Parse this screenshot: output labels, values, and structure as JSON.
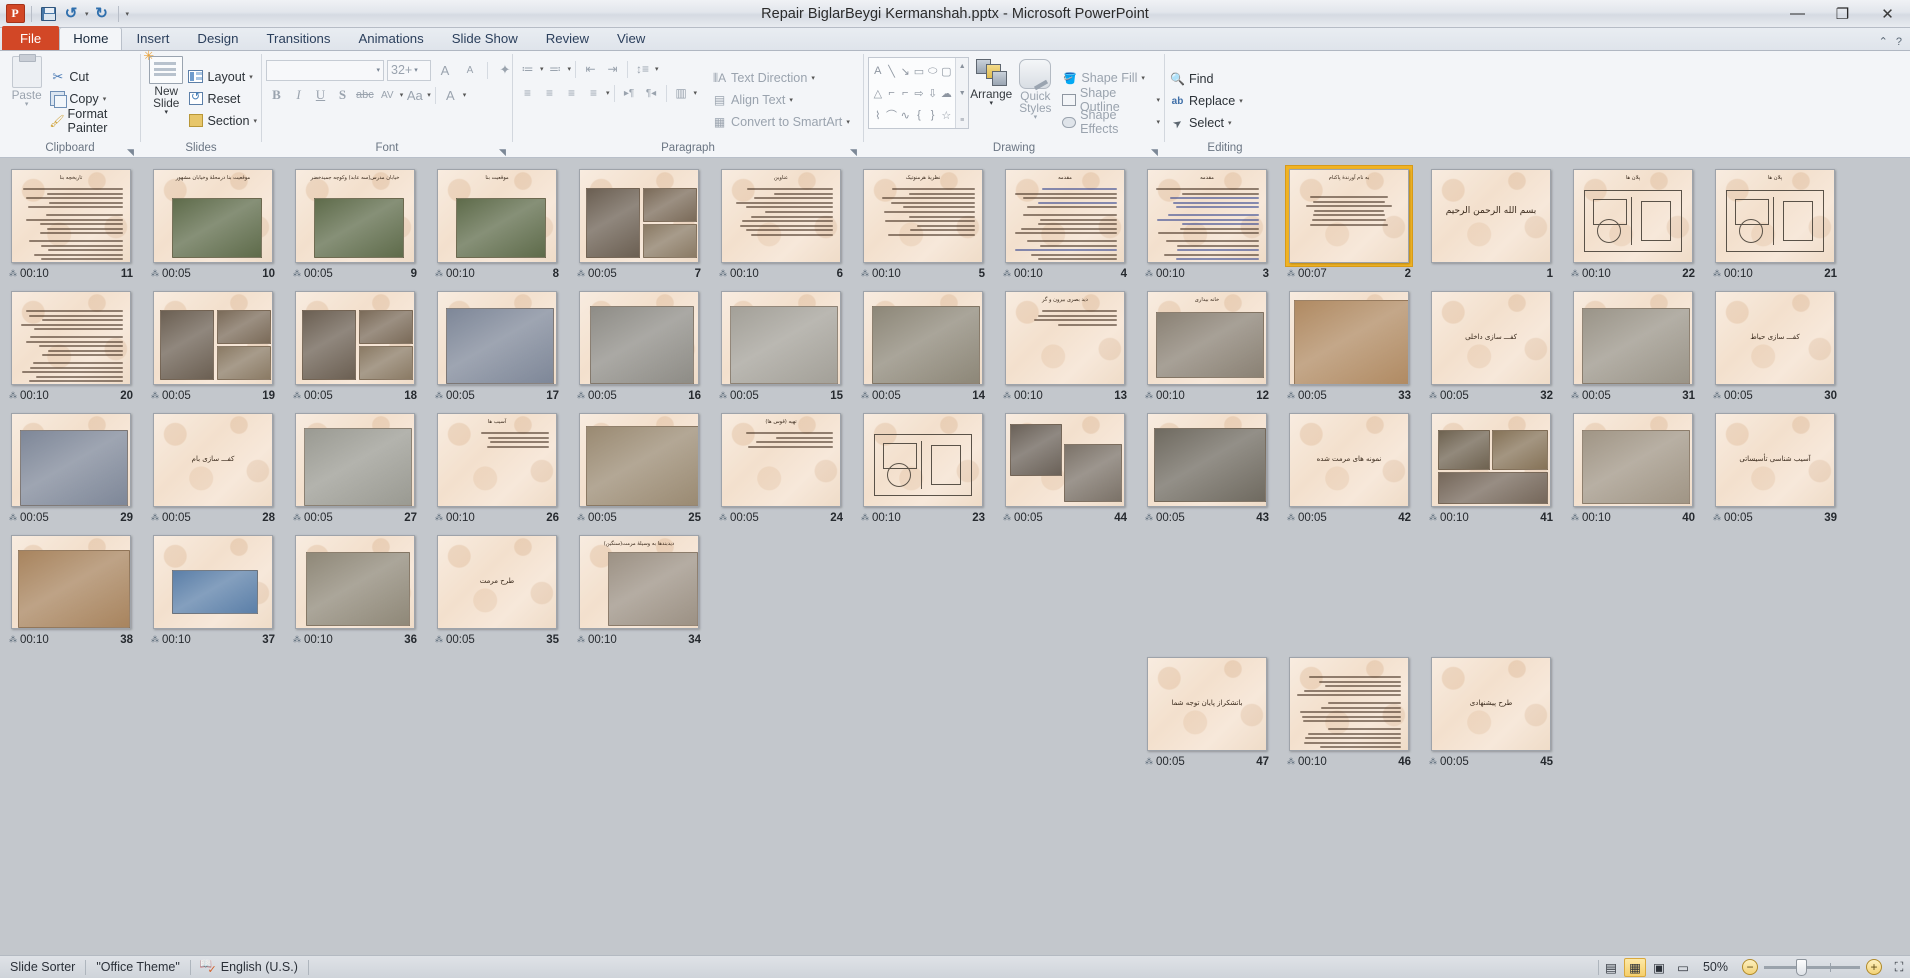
{
  "window": {
    "title": "Repair BiglarBeygi Kermanshah.pptx  -  Microsoft PowerPoint",
    "minimize": "—",
    "restore": "❐",
    "close": "✕"
  },
  "quick_access": {
    "app_logo": "P",
    "save": "save-icon",
    "undo": "↺",
    "undo_caret": "▾",
    "redo": "↻",
    "customize": "▾"
  },
  "tabs": [
    {
      "label": "File",
      "active": false,
      "file": true
    },
    {
      "label": "Home",
      "active": true,
      "file": false
    },
    {
      "label": "Insert",
      "active": false,
      "file": false
    },
    {
      "label": "Design",
      "active": false,
      "file": false
    },
    {
      "label": "Transitions",
      "active": false,
      "file": false
    },
    {
      "label": "Animations",
      "active": false,
      "file": false
    },
    {
      "label": "Slide Show",
      "active": false,
      "file": false
    },
    {
      "label": "Review",
      "active": false,
      "file": false
    },
    {
      "label": "View",
      "active": false,
      "file": false
    }
  ],
  "tabstrip_right": {
    "minimize_ribbon": "⌃",
    "help": "?"
  },
  "ribbon": {
    "clipboard": {
      "label": "Clipboard",
      "paste": "Paste",
      "paste_caret": "▾",
      "cut": "Cut",
      "copy": "Copy",
      "copy_caret": "▾",
      "format_painter": "Format Painter",
      "launcher": "◥"
    },
    "slides": {
      "label": "Slides",
      "new_slide": "New Slide",
      "new_slide_caret": "▾",
      "layout": "Layout",
      "layout_caret": "▾",
      "reset": "Reset",
      "section": "Section",
      "section_caret": "▾"
    },
    "font": {
      "label": "Font",
      "font_name": "",
      "font_size": "32+",
      "grow": "A",
      "shrink": "A",
      "clear_format": "✦",
      "bold": "B",
      "italic": "I",
      "underline": "U",
      "shadow": "S",
      "strikethrough": "abc",
      "spacing": "AV",
      "change_case": "Aa",
      "font_color": "A",
      "launcher": "◥"
    },
    "paragraph": {
      "label": "Paragraph",
      "bullets": "≔",
      "numbering": "≕",
      "dec_indent": "⇤",
      "inc_indent": "⇥",
      "line_spacing": "↕≡",
      "align_left": "≡",
      "align_center": "≡",
      "align_right": "≡",
      "justify": "≡",
      "ltr": "▸¶",
      "rtl": "¶◂",
      "columns": "▥",
      "text_direction": "Text Direction",
      "align_text": "Align Text",
      "convert_smartart": "Convert to SmartArt",
      "launcher": "◥"
    },
    "drawing": {
      "label": "Drawing",
      "shapes": [
        "A",
        "╲",
        "↘",
        "▭",
        "⬭",
        "▢",
        "△",
        "⌐",
        "⌐",
        "⇨",
        "⇩",
        "☁",
        "⌇",
        "⌒",
        "∿",
        "{",
        "}",
        "☆"
      ],
      "scroll_up": "▲",
      "scroll_down": "▼",
      "scroll_more": "≡",
      "arrange": "Arrange",
      "arrange_caret": "▾",
      "quick_styles": "Quick Styles",
      "quick_styles_caret": "▾",
      "shape_fill": "Shape Fill",
      "shape_outline": "Shape Outline",
      "shape_effects": "Shape Effects",
      "launcher": "◥"
    },
    "editing": {
      "label": "Editing",
      "find": "Find",
      "replace": "Replace",
      "replace_caret": "▾",
      "select": "Select",
      "select_caret": "▾"
    }
  },
  "status_bar": {
    "view_name": "Slide Sorter",
    "theme": "\"Office Theme\"",
    "spell_icon": "spellcheck-icon",
    "language": "English (U.S.)",
    "zoom_level": "50%",
    "zoom_out": "−",
    "zoom_in": "+",
    "fit_to_window": "⛶",
    "view_buttons": [
      {
        "name": "normal-view",
        "glyph": "▤",
        "active": false
      },
      {
        "name": "slide-sorter-view",
        "glyph": "▦",
        "active": true
      },
      {
        "name": "reading-view",
        "glyph": "▣",
        "active": false
      },
      {
        "name": "slide-show-view",
        "glyph": "▭",
        "active": false
      }
    ]
  },
  "slides": [
    {
      "n": 11,
      "time": "00:10",
      "title": "تاریخچه بنا",
      "kind": "text",
      "selected": false
    },
    {
      "n": 10,
      "time": "00:05",
      "title": "موقعیت بنا درمحلۀ وخیابان مشهور",
      "kind": "photo-aerial",
      "selected": false
    },
    {
      "n": 9,
      "time": "00:05",
      "title": "خیابان مدرس(سه عابد) وکوچه جمیدخضر",
      "kind": "photo-aerial",
      "selected": false
    },
    {
      "n": 8,
      "time": "00:10",
      "title": "موقعیت بنا",
      "kind": "photo-aerial",
      "selected": false
    },
    {
      "n": 7,
      "time": "00:05",
      "title": "",
      "kind": "photo-collage",
      "selected": false
    },
    {
      "n": 6,
      "time": "00:10",
      "title": "عناوین",
      "kind": "text2col",
      "selected": false
    },
    {
      "n": 5,
      "time": "00:10",
      "title": "نظریۀ هرمنوتیک",
      "kind": "text2col",
      "selected": false
    },
    {
      "n": 4,
      "time": "00:10",
      "title": "مقدمه",
      "kind": "text-links",
      "selected": false
    },
    {
      "n": 3,
      "time": "00:10",
      "title": "مقدمه",
      "kind": "text-links",
      "selected": false
    },
    {
      "n": 2,
      "time": "00:07",
      "title": "به نام آورندۀ پاکنام",
      "kind": "poem",
      "selected": true
    },
    {
      "n": 1,
      "time": "",
      "title": "بسم الله الرحمن الرحیم",
      "kind": "bismillah",
      "selected": false
    },
    {
      "n": 22,
      "time": "00:10",
      "title": "پلان ها",
      "kind": "plan",
      "selected": false
    },
    {
      "n": 21,
      "time": "00:10",
      "title": "پلان ها",
      "kind": "plan",
      "selected": false
    },
    {
      "n": 20,
      "time": "00:10",
      "title": "",
      "kind": "text",
      "selected": false
    },
    {
      "n": 19,
      "time": "00:05",
      "title": "",
      "kind": "photo-collage",
      "selected": false
    },
    {
      "n": 18,
      "time": "00:05",
      "title": "",
      "kind": "photo-collage",
      "selected": false
    },
    {
      "n": 17,
      "time": "00:05",
      "title": "",
      "kind": "photo-floor",
      "selected": false
    },
    {
      "n": 16,
      "time": "00:05",
      "title": "",
      "kind": "photo-interior",
      "selected": false
    },
    {
      "n": 15,
      "time": "00:05",
      "title": "",
      "kind": "photo-facade",
      "selected": false
    },
    {
      "n": 14,
      "time": "00:05",
      "title": "",
      "kind": "photo-alley",
      "selected": false
    },
    {
      "n": 13,
      "time": "00:10",
      "title": "دید بصری بیرون و گر",
      "kind": "text-small",
      "selected": false
    },
    {
      "n": 12,
      "time": "00:10",
      "title": "خانه بیداری",
      "kind": "photo-arch",
      "selected": false
    },
    {
      "n": 33,
      "time": "00:05",
      "title": "",
      "kind": "photo-tile",
      "selected": false
    },
    {
      "n": 32,
      "time": "00:05",
      "title": "کفـــ سازی داخلی",
      "kind": "title-only",
      "selected": false
    },
    {
      "n": 31,
      "time": "00:05",
      "title": "",
      "kind": "photo-floor2",
      "selected": false
    },
    {
      "n": 30,
      "time": "00:05",
      "title": "کفـــ سازی حیاط",
      "kind": "title-only",
      "selected": false
    },
    {
      "n": 29,
      "time": "00:05",
      "title": "",
      "kind": "photo-floor",
      "selected": false
    },
    {
      "n": 28,
      "time": "00:05",
      "title": "کفـــ سازی بام",
      "kind": "title-only",
      "selected": false
    },
    {
      "n": 27,
      "time": "00:05",
      "title": "",
      "kind": "photo-facade2",
      "selected": false
    },
    {
      "n": 26,
      "time": "00:10",
      "title": "آسیب ها",
      "kind": "text-small",
      "selected": false
    },
    {
      "n": 25,
      "time": "00:05",
      "title": "",
      "kind": "photo-vault",
      "selected": false
    },
    {
      "n": 24,
      "time": "00:05",
      "title": "تهیه (قوس ها)",
      "kind": "text-small",
      "selected": false
    },
    {
      "n": 23,
      "time": "00:10",
      "title": "",
      "kind": "plan2",
      "selected": false
    },
    {
      "n": 44,
      "time": "00:05",
      "title": "",
      "kind": "photo-hist",
      "selected": false
    },
    {
      "n": 43,
      "time": "00:05",
      "title": "",
      "kind": "photo-hist2",
      "selected": false
    },
    {
      "n": 42,
      "time": "00:05",
      "title": "نمونه های مرمت شده",
      "kind": "title-only",
      "selected": false
    },
    {
      "n": 41,
      "time": "00:10",
      "title": "",
      "kind": "photo-collage2",
      "selected": false
    },
    {
      "n": 40,
      "time": "00:10",
      "title": "",
      "kind": "photo-corridor",
      "selected": false
    },
    {
      "n": 39,
      "time": "00:05",
      "title": "آسیب شناسی تأسیساتی",
      "kind": "title-only",
      "selected": false
    },
    {
      "n": 38,
      "time": "00:10",
      "title": "",
      "kind": "photo-tile2",
      "selected": false
    },
    {
      "n": 37,
      "time": "00:10",
      "title": "",
      "kind": "photo-sky",
      "selected": false
    },
    {
      "n": 36,
      "time": "00:10",
      "title": "",
      "kind": "photo-courtyard",
      "selected": false
    },
    {
      "n": 35,
      "time": "00:05",
      "title": "طرح مرمت",
      "kind": "title-only",
      "selected": false
    },
    {
      "n": 34,
      "time": "00:10",
      "title": "دیدبندها به وسیلۀ مرمت(سنگین)",
      "kind": "photo-arch2",
      "selected": false
    },
    {
      "n": 47,
      "time": "00:05",
      "title": "باتشکراز پایان توجه شما",
      "kind": "title-only",
      "selected": false
    },
    {
      "n": 46,
      "time": "00:10",
      "title": "",
      "kind": "text",
      "selected": false
    },
    {
      "n": 45,
      "time": "00:05",
      "title": "طرح پیشنهادی",
      "kind": "title-only",
      "selected": false
    }
  ]
}
